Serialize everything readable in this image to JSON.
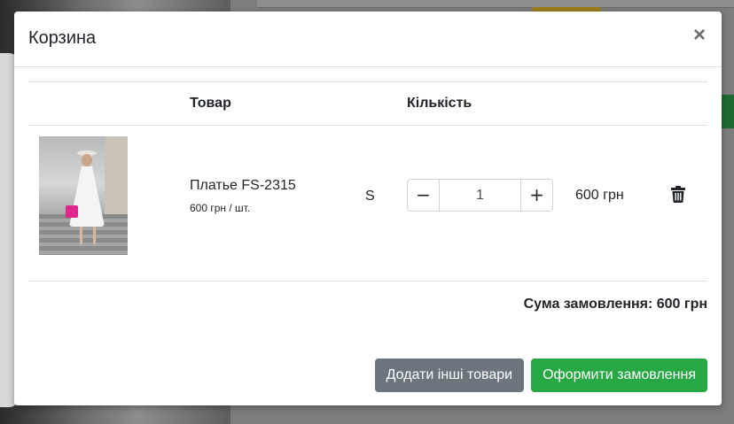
{
  "modal": {
    "title": "Корзина",
    "close_symbol": "×"
  },
  "table": {
    "headers": {
      "product": "Товар",
      "quantity": "Кількість"
    },
    "rows": [
      {
        "name": "Платье FS-2315",
        "unit_price": "600 грн / шт.",
        "size": "S",
        "quantity": "1",
        "minus_symbol": "−",
        "plus_symbol": "+",
        "total": "600 грн",
        "image_icon": "product-photo",
        "delete_icon": "trash-icon"
      }
    ]
  },
  "summary": {
    "text": "Сума замовлення: 600 грн"
  },
  "footer": {
    "add_more_label": "Додати інші товари",
    "checkout_label": "Оформити замовлення"
  },
  "colors": {
    "primary_green": "#28a745",
    "secondary_gray": "#6c757d"
  }
}
